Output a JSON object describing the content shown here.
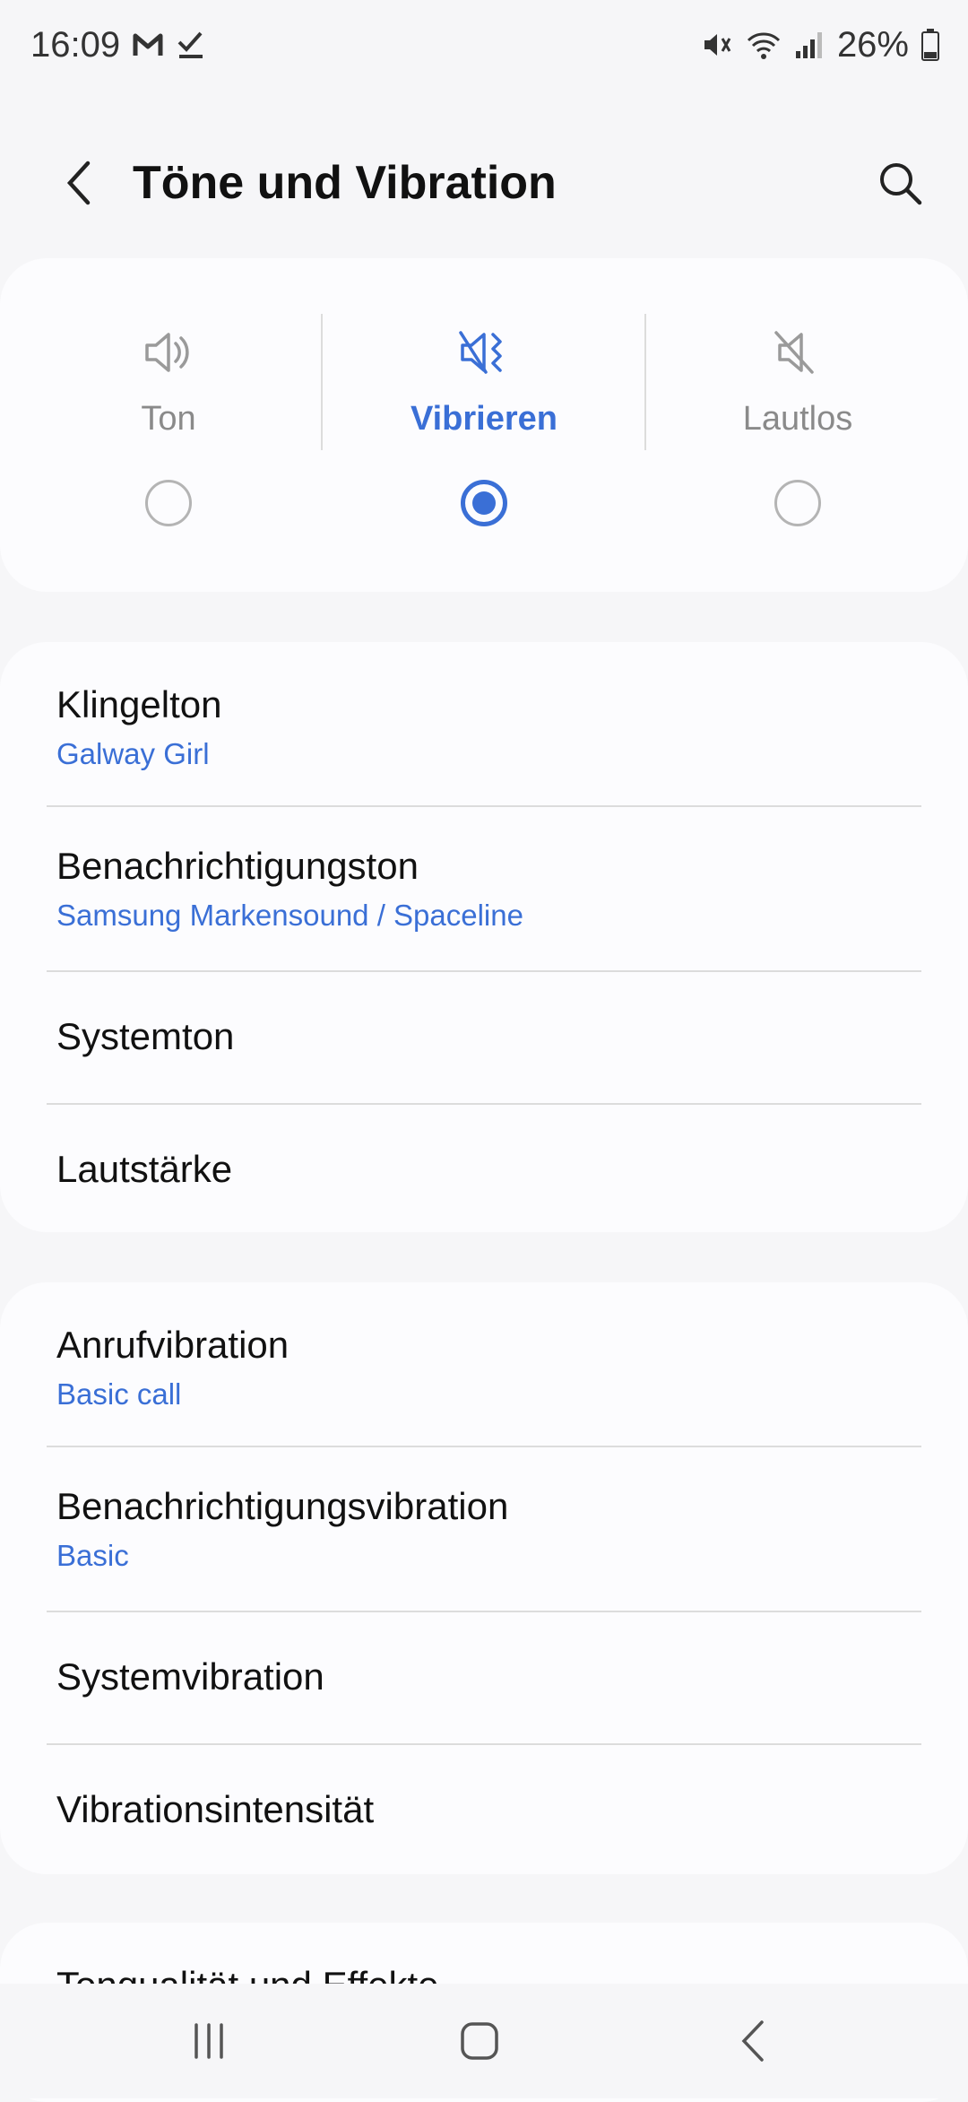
{
  "status_bar": {
    "time": "16:09",
    "battery": "26%",
    "icons": [
      "gmail-icon",
      "check-icon",
      "mute-vibrate-icon",
      "wifi-icon",
      "signal-icon",
      "battery-icon"
    ]
  },
  "header": {
    "title": "Töne und Vibration"
  },
  "sound_modes": [
    {
      "label": "Ton",
      "icon": "speaker-icon",
      "selected": false
    },
    {
      "label": "Vibrieren",
      "icon": "vibrate-icon",
      "selected": true
    },
    {
      "label": "Lautlos",
      "icon": "mute-icon",
      "selected": false
    }
  ],
  "group1": [
    {
      "title": "Klingelton",
      "subtitle": "Galway Girl"
    },
    {
      "title": "Benachrichtigungston",
      "subtitle": "Samsung Markensound / Spaceline"
    },
    {
      "title": "Systemton"
    },
    {
      "title": "Lautstärke"
    }
  ],
  "group2": [
    {
      "title": "Anrufvibration",
      "subtitle": "Basic call"
    },
    {
      "title": "Benachrichtigungsvibration",
      "subtitle": "Basic"
    },
    {
      "title": "Systemvibration"
    },
    {
      "title": "Vibrationsintensität"
    }
  ],
  "group3": [
    {
      "title": "Tonqualität und Effekte"
    }
  ],
  "colors": {
    "accent": "#3a6fd6",
    "background": "#f6f6f8",
    "card": "#fcfcfe"
  }
}
